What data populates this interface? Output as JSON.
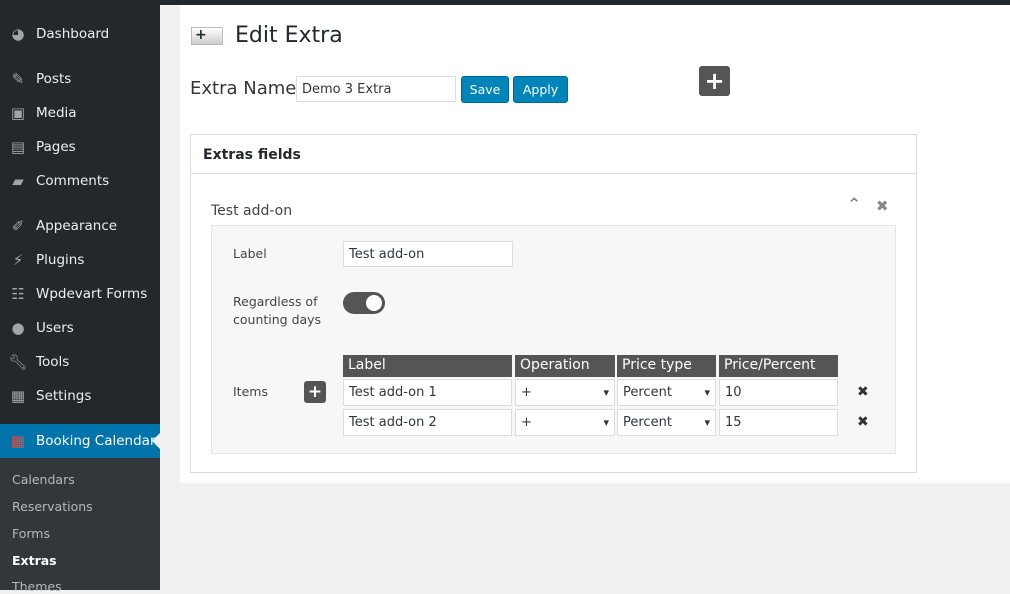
{
  "sidebar": {
    "items": [
      {
        "label": "Dashboard",
        "icon": "dashboard-icon"
      },
      {
        "label": "Posts",
        "icon": "pin-icon"
      },
      {
        "label": "Media",
        "icon": "media-icon"
      },
      {
        "label": "Pages",
        "icon": "pages-icon"
      },
      {
        "label": "Comments",
        "icon": "comment-icon"
      },
      {
        "label": "Appearance",
        "icon": "brush-icon"
      },
      {
        "label": "Plugins",
        "icon": "plugin-icon"
      },
      {
        "label": "Wpdevart Forms",
        "icon": "form-icon"
      },
      {
        "label": "Users",
        "icon": "user-icon"
      },
      {
        "label": "Tools",
        "icon": "wrench-icon"
      },
      {
        "label": "Settings",
        "icon": "settings-icon"
      },
      {
        "label": "Booking Calendar",
        "icon": "calendar-icon"
      }
    ],
    "submenu": [
      "Calendars",
      "Reservations",
      "Forms",
      "Extras",
      "Themes"
    ]
  },
  "page": {
    "title": "Edit Extra",
    "name_label": "Extra Name",
    "name_value": "Demo 3 Extra",
    "save": "Save",
    "apply": "Apply"
  },
  "box": {
    "title": "Extras fields",
    "field_title": "Test add-on",
    "label_label": "Label",
    "label_value": "Test add-on",
    "toggle_label_1": "Regardless of",
    "toggle_label_2": "counting days",
    "toggle_on": true,
    "items_label": "Items",
    "headers": [
      "Label",
      "Operation",
      "Price type",
      "Price/Percent"
    ],
    "rows": [
      {
        "label": "Test add-on 1",
        "op": "+",
        "type": "Percent",
        "value": "10"
      },
      {
        "label": "Test add-on 2",
        "op": "+",
        "type": "Percent",
        "value": "15"
      }
    ]
  }
}
